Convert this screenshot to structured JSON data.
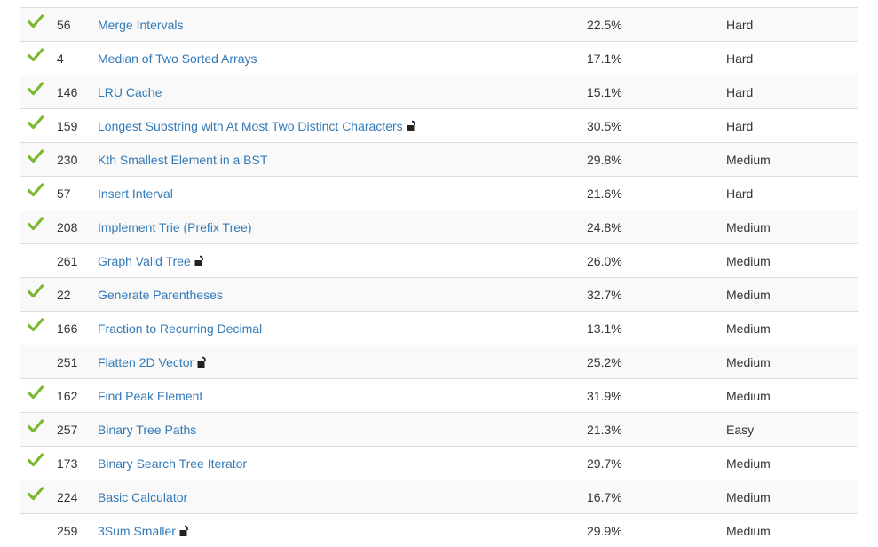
{
  "problems": [
    {
      "solved": true,
      "number": "56",
      "title": "Merge Intervals",
      "locked": false,
      "acceptance": "22.5%",
      "difficulty": "Hard"
    },
    {
      "solved": true,
      "number": "4",
      "title": "Median of Two Sorted Arrays",
      "locked": false,
      "acceptance": "17.1%",
      "difficulty": "Hard"
    },
    {
      "solved": true,
      "number": "146",
      "title": "LRU Cache",
      "locked": false,
      "acceptance": "15.1%",
      "difficulty": "Hard"
    },
    {
      "solved": true,
      "number": "159",
      "title": "Longest Substring with At Most Two Distinct Characters",
      "locked": true,
      "acceptance": "30.5%",
      "difficulty": "Hard"
    },
    {
      "solved": true,
      "number": "230",
      "title": "Kth Smallest Element in a BST",
      "locked": false,
      "acceptance": "29.8%",
      "difficulty": "Medium"
    },
    {
      "solved": true,
      "number": "57",
      "title": "Insert Interval",
      "locked": false,
      "acceptance": "21.6%",
      "difficulty": "Hard"
    },
    {
      "solved": true,
      "number": "208",
      "title": "Implement Trie (Prefix Tree)",
      "locked": false,
      "acceptance": "24.8%",
      "difficulty": "Medium"
    },
    {
      "solved": false,
      "number": "261",
      "title": "Graph Valid Tree",
      "locked": true,
      "acceptance": "26.0%",
      "difficulty": "Medium"
    },
    {
      "solved": true,
      "number": "22",
      "title": "Generate Parentheses",
      "locked": false,
      "acceptance": "32.7%",
      "difficulty": "Medium"
    },
    {
      "solved": true,
      "number": "166",
      "title": "Fraction to Recurring Decimal",
      "locked": false,
      "acceptance": "13.1%",
      "difficulty": "Medium"
    },
    {
      "solved": false,
      "number": "251",
      "title": "Flatten 2D Vector",
      "locked": true,
      "acceptance": "25.2%",
      "difficulty": "Medium"
    },
    {
      "solved": true,
      "number": "162",
      "title": "Find Peak Element",
      "locked": false,
      "acceptance": "31.9%",
      "difficulty": "Medium"
    },
    {
      "solved": true,
      "number": "257",
      "title": "Binary Tree Paths",
      "locked": false,
      "acceptance": "21.3%",
      "difficulty": "Easy"
    },
    {
      "solved": true,
      "number": "173",
      "title": "Binary Search Tree Iterator",
      "locked": false,
      "acceptance": "29.7%",
      "difficulty": "Medium"
    },
    {
      "solved": true,
      "number": "224",
      "title": "Basic Calculator",
      "locked": false,
      "acceptance": "16.7%",
      "difficulty": "Medium"
    },
    {
      "solved": false,
      "number": "259",
      "title": "3Sum Smaller",
      "locked": true,
      "acceptance": "29.9%",
      "difficulty": "Medium"
    }
  ],
  "colors": {
    "check": "#7cb82f",
    "link": "#337ab7",
    "stripe": "#f9f9f9",
    "border": "#dddddd"
  }
}
